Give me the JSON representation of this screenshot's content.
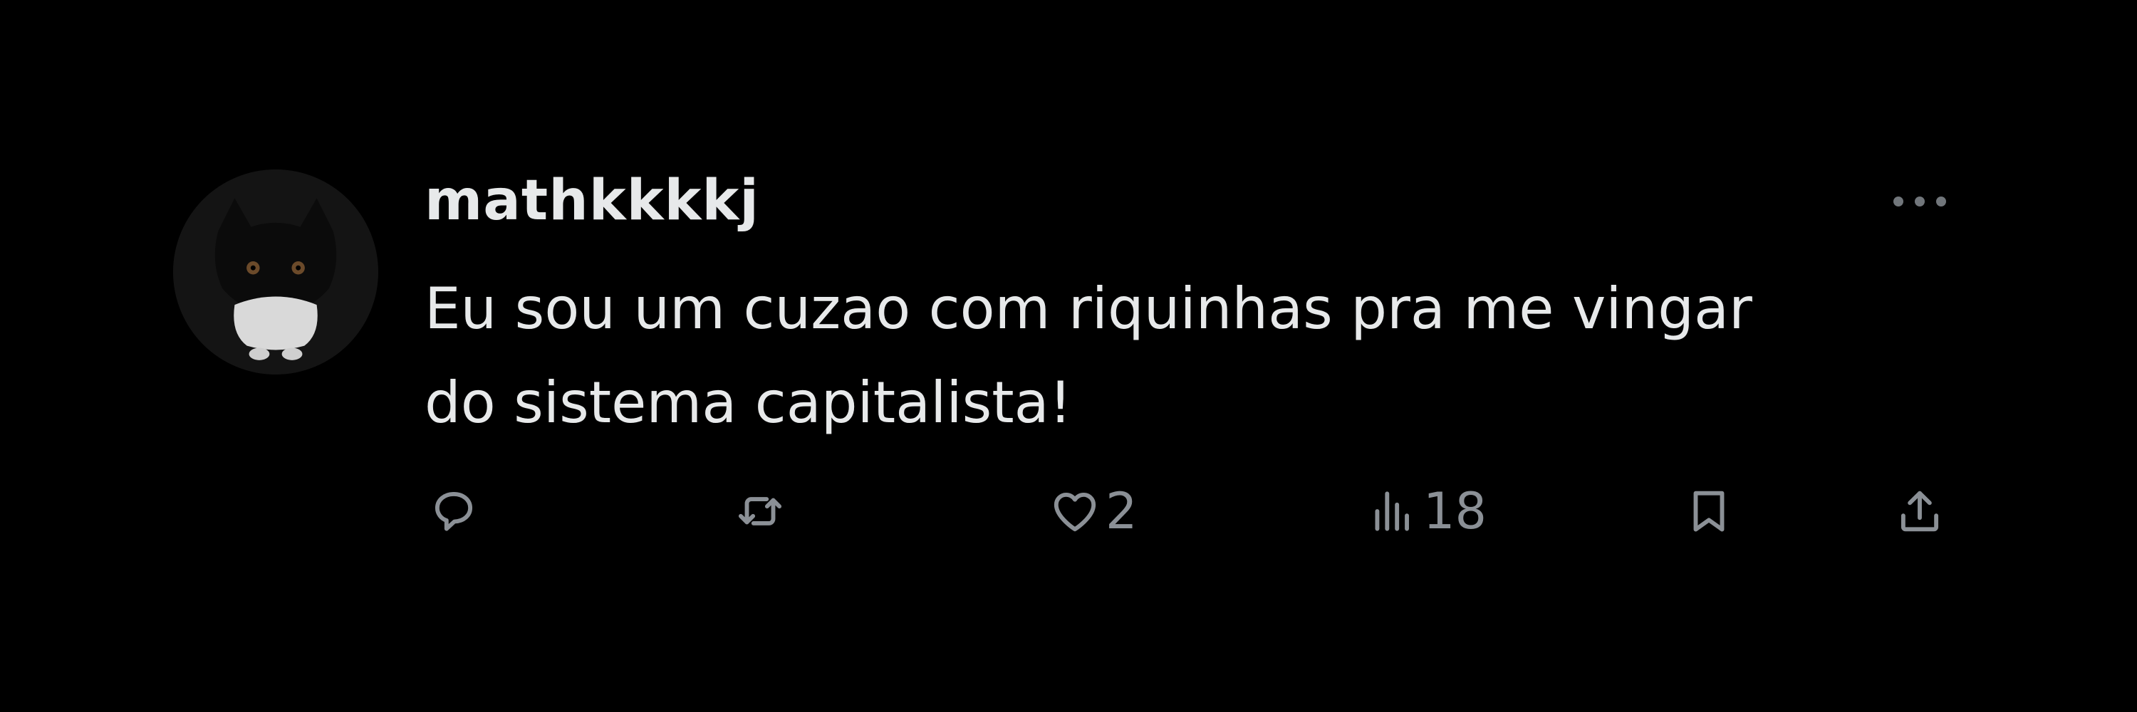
{
  "tweet": {
    "username": "mathkkkkj",
    "text": "Eu sou um cuzao com riquinhas pra me vingar\ndo sistema capitalista!",
    "likes": "2",
    "views": "18"
  },
  "icons": {
    "avatar": "cat-avatar",
    "more": "more-icon",
    "reply": "reply-icon",
    "retweet": "retweet-icon",
    "like": "heart-icon",
    "views": "views-icon",
    "bookmark": "bookmark-icon",
    "share": "share-icon"
  },
  "colors": {
    "background": "#000000",
    "text": "#e7e9ea",
    "secondary": "#71767b"
  }
}
